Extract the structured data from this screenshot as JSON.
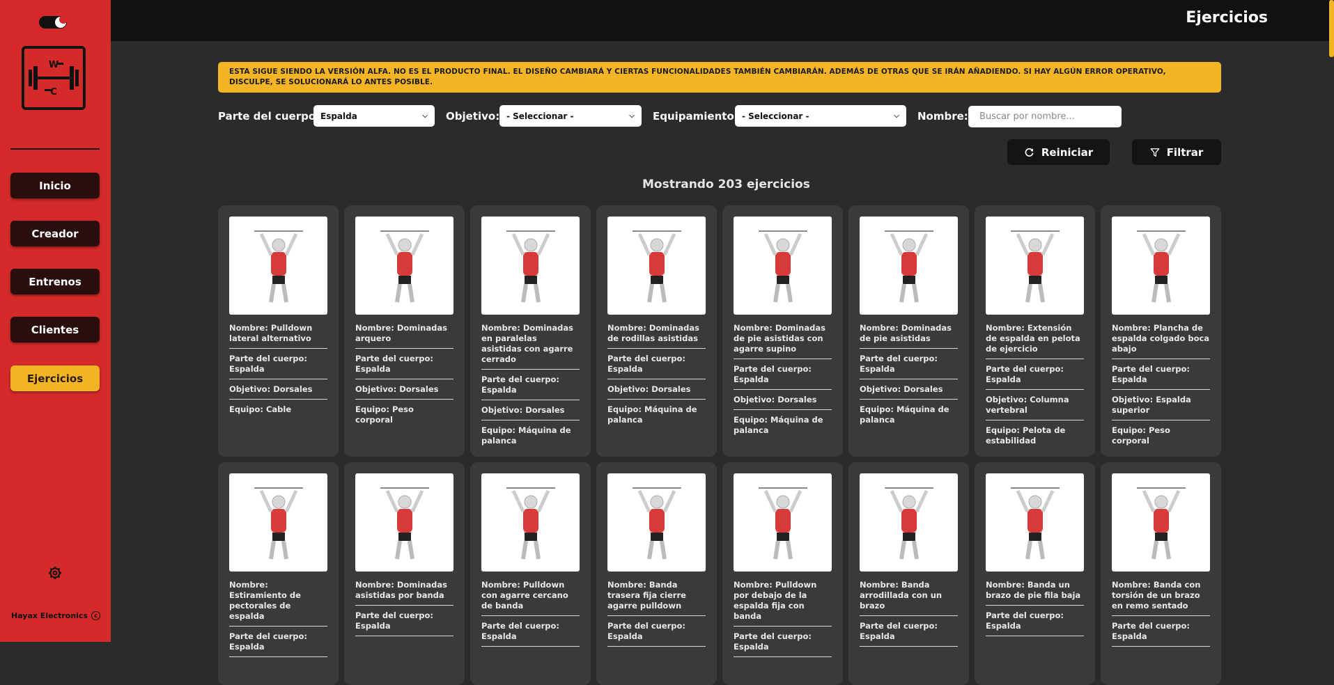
{
  "header": {
    "title": "Ejercicios"
  },
  "sidebar": {
    "items": [
      {
        "label": "Inicio",
        "active": false
      },
      {
        "label": "Creador",
        "active": false
      },
      {
        "label": "Entrenos",
        "active": false
      },
      {
        "label": "Clientes",
        "active": false
      },
      {
        "label": "Ejercicios",
        "active": true
      }
    ],
    "logo_text": [
      "W",
      "C"
    ],
    "footer": "Hayax Electronics",
    "footer_icon": "copyright-icon",
    "settings_icon": "gear-icon",
    "theme_toggle_icon": "theme-toggle-icon"
  },
  "alert": {
    "text": "ESTA SIGUE SIENDO LA VERSIÓN ALFA. NO ES EL PRODUCTO FINAL. EL DISEÑO CAMBIARÁ Y CIERTAS FUNCIONALIDADES TAMBIÉN CAMBIARÁN. ADEMÁS DE OTRAS QUE SE IRÁN AÑADIENDO. SI HAY ALGÚN ERROR OPERATIVO, DISCULPE, SE SOLUCIONARÁ LO ANTES POSIBLE."
  },
  "filters": {
    "body_part_label": "Parte del cuerpo:",
    "body_part_value": "Espalda",
    "target_label": "Objetivo:",
    "target_value": "- Seleccionar -",
    "equipment_label": "Equipamiento:",
    "equipment_value": "- Seleccionar -",
    "name_label": "Nombre:",
    "name_placeholder": "Buscar por nombre..."
  },
  "actions": {
    "reset_label": "Reiniciar",
    "filter_label": "Filtrar"
  },
  "results": {
    "count_text": "Mostrando 203 ejercicios"
  },
  "cards": [
    {
      "name": "Nombre: Pulldown lateral alternativo",
      "body": "Parte del cuerpo: Espalda",
      "target": "Objetivo: Dorsales",
      "equip": "Equipo: Cable"
    },
    {
      "name": "Nombre: Dominadas arquero",
      "body": "Parte del cuerpo: Espalda",
      "target": "Objetivo: Dorsales",
      "equip": "Equipo: Peso corporal"
    },
    {
      "name": "Nombre: Dominadas en paralelas asistidas con agarre cerrado",
      "body": "Parte del cuerpo: Espalda",
      "target": "Objetivo: Dorsales",
      "equip": "Equipo: Máquina de palanca"
    },
    {
      "name": "Nombre: Dominadas de rodillas asistidas",
      "body": "Parte del cuerpo: Espalda",
      "target": "Objetivo: Dorsales",
      "equip": "Equipo: Máquina de palanca"
    },
    {
      "name": "Nombre: Dominadas de pie asistidas con agarre supino",
      "body": "Parte del cuerpo: Espalda",
      "target": "Objetivo: Dorsales",
      "equip": "Equipo: Máquina de palanca"
    },
    {
      "name": "Nombre: Dominadas de pie asistidas",
      "body": "Parte del cuerpo: Espalda",
      "target": "Objetivo: Dorsales",
      "equip": "Equipo: Máquina de palanca"
    },
    {
      "name": "Nombre: Extensión de espalda en pelota de ejercicio",
      "body": "Parte del cuerpo: Espalda",
      "target": "Objetivo: Columna vertebral",
      "equip": "Equipo: Pelota de estabilidad"
    },
    {
      "name": "Nombre: Plancha de espalda colgado boca abajo",
      "body": "Parte del cuerpo: Espalda",
      "target": "Objetivo: Espalda superior",
      "equip": "Equipo: Peso corporal"
    },
    {
      "name": "Nombre: Estiramiento de pectorales de espalda",
      "body": "Parte del cuerpo: Espalda",
      "target": "",
      "equip": ""
    },
    {
      "name": "Nombre: Dominadas asistidas por banda",
      "body": "Parte del cuerpo: Espalda",
      "target": "",
      "equip": ""
    },
    {
      "name": "Nombre: Pulldown con agarre cercano de banda",
      "body": "Parte del cuerpo: Espalda",
      "target": "",
      "equip": ""
    },
    {
      "name": "Nombre: Banda trasera fija cierre agarre pulldown",
      "body": "Parte del cuerpo: Espalda",
      "target": "",
      "equip": ""
    },
    {
      "name": "Nombre: Pulldown por debajo de la espalda fija con banda",
      "body": "Parte del cuerpo: Espalda",
      "target": "",
      "equip": ""
    },
    {
      "name": "Nombre: Banda arrodillada con un brazo",
      "body": "Parte del cuerpo: Espalda",
      "target": "",
      "equip": ""
    },
    {
      "name": "Nombre: Banda un brazo de pie fila baja",
      "body": "Parte del cuerpo: Espalda",
      "target": "",
      "equip": ""
    },
    {
      "name": "Nombre: Banda con torsión de un brazo en remo sentado",
      "body": "Parte del cuerpo: Espalda",
      "target": "",
      "equip": ""
    }
  ],
  "colors": {
    "accent": "#f3b526",
    "sidebar": "#d42a2a",
    "card": "#3a3a3a",
    "muscle": "#d83a3a"
  }
}
